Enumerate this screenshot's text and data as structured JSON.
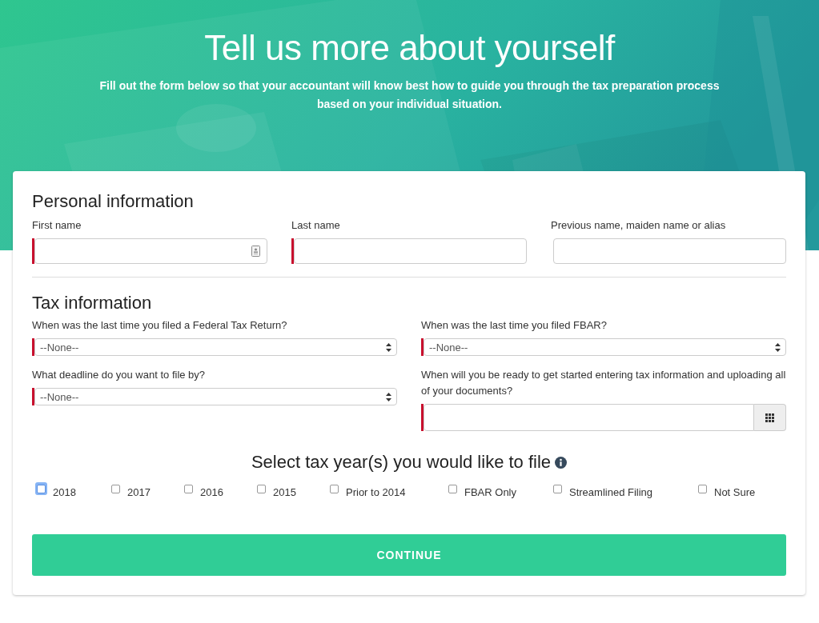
{
  "header": {
    "title": "Tell us more about yourself",
    "subtitle": "Fill out the form below so that your accountant will know best how to guide you through the tax preparation process based on your individual situation."
  },
  "personal_information": {
    "heading": "Personal information",
    "fields": [
      {
        "label": "First name",
        "kind": "contact",
        "required": true
      },
      {
        "label": "Last name",
        "kind": "text",
        "required": true
      },
      {
        "label": "Previous name, maiden name or alias",
        "kind": "text",
        "required": false
      }
    ]
  },
  "tax_information": {
    "heading": "Tax information",
    "fields": [
      {
        "label": "When was the last time you filed a Federal Tax Return?",
        "kind": "select",
        "value": "--None--",
        "required": true
      },
      {
        "label": "When was the last time you filed FBAR?",
        "kind": "select",
        "value": "--None--",
        "required": true
      },
      {
        "label": "What deadline do you want to file by?",
        "kind": "select",
        "value": "--None--",
        "required": true
      },
      {
        "label": "When will you be ready to get started entering tax information and uploading all of your documents?",
        "kind": "date",
        "required": true
      }
    ]
  },
  "tax_years": {
    "heading": "Select tax year(s) you would like to file",
    "options": [
      {
        "label": "2018",
        "checked": false,
        "focused": true
      },
      {
        "label": "2017",
        "checked": false,
        "focused": false
      },
      {
        "label": "2016",
        "checked": false,
        "focused": false
      },
      {
        "label": "2015",
        "checked": false,
        "focused": false
      },
      {
        "label": "Prior to 2014",
        "checked": false,
        "focused": false
      },
      {
        "label": "FBAR Only",
        "checked": false,
        "focused": false
      },
      {
        "label": "Streamlined Filing",
        "checked": false,
        "focused": false
      },
      {
        "label": "Not Sure",
        "checked": false,
        "focused": false
      }
    ]
  },
  "continue_button": "CONTINUE"
}
